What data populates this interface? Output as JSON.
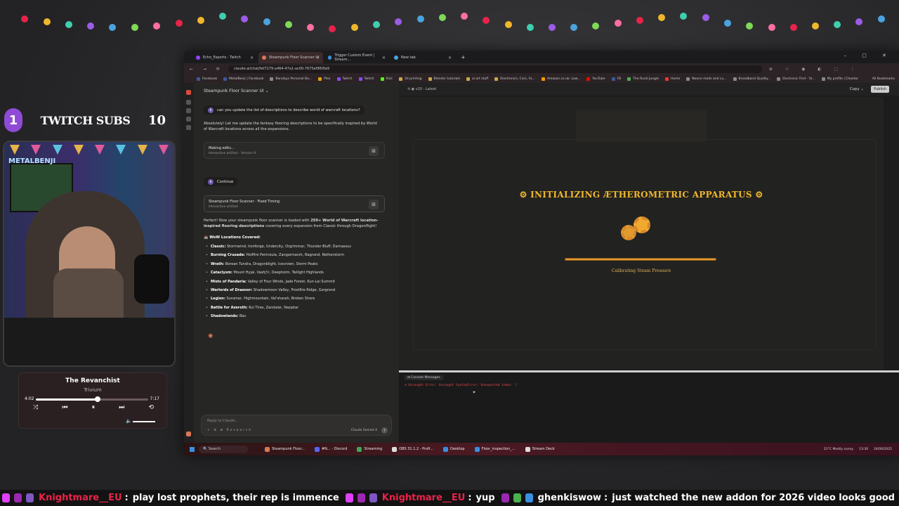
{
  "overlay": {
    "subs_left": "1",
    "subs_label": "TWITCH SUBS",
    "subs_count": "10",
    "cam_tag": "METALBENJI"
  },
  "music_player": {
    "title": "The Revanchist",
    "artist": "Trivium",
    "time_current": "4:02",
    "time_total": "7:17",
    "progress": 0.55,
    "volume": 0.85,
    "controls": {
      "shuffle": "⤨",
      "prev": "⏮",
      "play": "⏸",
      "next": "⏭",
      "repeat": "⟲",
      "volume": "🔈"
    }
  },
  "browser": {
    "tabs": [
      {
        "label": "Echo_Esports - Twitch",
        "color": "#9146ff",
        "active": false
      },
      {
        "label": "Steampunk Floor Scanner UI",
        "color": "#d97757",
        "active": true
      },
      {
        "label": "Trigger Custom Event | Stream...",
        "color": "#3a8fe0",
        "active": false
      },
      {
        "label": "New tab",
        "color": "#4aa3df",
        "active": false
      }
    ],
    "new_tab": "+",
    "window_controls": "– ▢ ✕",
    "nav": "← → ⟳",
    "url": "claude.ai/chat/fef7279-a464-47a1-ac00-7675af960fa9",
    "extensions": "⊕ ☆ ◉ ◐ ⬚ ⋮",
    "bookmarks": [
      {
        "label": "Facebook",
        "color": "#3b5998"
      },
      {
        "label": "MetalBenji | Facebook",
        "color": "#3b5998"
      },
      {
        "label": "Bandaya Personal Ba...",
        "color": "#888"
      },
      {
        "label": "Plex",
        "color": "#e5a00d"
      },
      {
        "label": "Twitch",
        "color": "#9146ff"
      },
      {
        "label": "Twitch",
        "color": "#9146ff"
      },
      {
        "label": "Kick",
        "color": "#53fc18"
      },
      {
        "label": "3d printing",
        "color": "#caa84a"
      },
      {
        "label": "Blender tutorials",
        "color": "#caa84a"
      },
      {
        "label": "ai art stuff",
        "color": "#caa84a"
      },
      {
        "label": "Electronics, Cars, Fa...",
        "color": "#caa84a"
      },
      {
        "label": "Amazon.co.uk: Low...",
        "color": "#ff9900"
      },
      {
        "label": "YouTube",
        "color": "#ff0000"
      },
      {
        "label": "FB",
        "color": "#3b5998"
      },
      {
        "label": "The Rural Jungle",
        "color": "#4caf50"
      },
      {
        "label": "Home",
        "color": "#e53935"
      },
      {
        "label": "Noone mods and cu...",
        "color": "#888"
      },
      {
        "label": "Broadband Quality...",
        "color": "#888"
      },
      {
        "label": "Electronic Find - Ya...",
        "color": "#888"
      },
      {
        "label": "My profile | Clearbo",
        "color": "#888"
      }
    ],
    "all_bookmarks": "All Bookmarks"
  },
  "chat": {
    "title": "Steampunk Floor Scanner UI ⌄",
    "user_msg_1": "can you update the list of descriptions to describe world of warcraft locations?",
    "reply_1": "Absolutely! Let me update the fantasy flooring descriptions to be specifically inspired by World of Warcraft locations across all the expansions.",
    "artifact_1_title": "Making edits...",
    "artifact_1_sub": "Interactive artifact · Version 9",
    "user_msg_2": "Continue",
    "artifact_2_title": "Steampunk Floor Scanner - Fixed Timing",
    "artifact_2_sub": "Interactive artifact",
    "reply_2_a": "Perfect! Now your steampunk floor scanner is loaded with ",
    "reply_2_b": "250+ World of Warcraft location-inspired flooring descriptions",
    "reply_2_c": " covering every expansion from Classic through Dragonflight!",
    "locations_heading": "🏰 WoW Locations Covered:",
    "locations": [
      {
        "exp": "Classic:",
        "list": "Stormwind, Ironforge, Undercity, Orgrimmar, Thunder Bluff, Darnassus"
      },
      {
        "exp": "Burning Crusade:",
        "list": "Hellfire Peninsula, Zangarmarsh, Nagrand, Netherstorm"
      },
      {
        "exp": "Wrath:",
        "list": "Borean Tundra, Dragonblight, Icecrown, Storm Peaks"
      },
      {
        "exp": "Cataclysm:",
        "list": "Mount Hyjal, Vashj'ir, Deepholm, Twilight Highlands"
      },
      {
        "exp": "Mists of Pandaria:",
        "list": "Valley of Four Winds, Jade Forest, Kun-Lai Summit"
      },
      {
        "exp": "Warlords of Draenor:",
        "list": "Shadowmoon Valley, Frostfire Ridge, Gorgrond"
      },
      {
        "exp": "Legion:",
        "list": "Suramar, Highmountain, Val'sharah, Broken Shore"
      },
      {
        "exp": "Battle for Azeroth:",
        "list": "Kul Tiras, Zandalar, Nazjatar"
      },
      {
        "exp": "Shadowlands:",
        "list": "Bas"
      }
    ],
    "input_placeholder": "Reply to Claude...",
    "input_tools": "+ ⇅ ⊕ Research",
    "model": "Claude Sonnet 4",
    "send": "↑"
  },
  "artifact": {
    "header_left": "⟲ ◉ v10 · Latest",
    "copy": "Copy ⌄",
    "publish": "Publish",
    "loading_title": "⚙ INITIALIZING ÆTHEROMETRIC APPARATUS ⚙",
    "progress": 1.0,
    "status": "Calibrating Steam Pressure",
    "console_header": "⊟ Console Messages",
    "console_error": "⊗ Uncaught Error: Uncaught SyntaxError: Unexpected token '}'"
  },
  "taskbar": {
    "search": "🔍 Search",
    "items": [
      {
        "label": "Steampunk Floor...",
        "color": "#d97757"
      },
      {
        "label": "#N... - Discord",
        "color": "#5865f2"
      },
      {
        "label": "Streaming",
        "color": "#3ea55c"
      },
      {
        "label": "OBS 31.1.2 - Profi...",
        "color": "#ddd"
      },
      {
        "label": "Desktop",
        "color": "#3a8fe0"
      },
      {
        "label": "Floor_inspection_...",
        "color": "#3a8fe0"
      },
      {
        "label": "Stream Deck",
        "color": "#ddd"
      }
    ],
    "weather": "21°C Mostly sunny",
    "time": "13:30",
    "date": "24/06/2025"
  },
  "ticker": [
    {
      "user": "Knightmare__EU",
      "msg": "play lost prophets, their rep is immence",
      "user_color": "#e8234a"
    },
    {
      "user": "Knightmare__EU",
      "msg": "yup",
      "user_color": "#e8234a"
    },
    {
      "user": "ghenkiswow",
      "msg": "just watched the new addon for 2026 video looks good",
      "user_color": "#ffffff"
    }
  ]
}
